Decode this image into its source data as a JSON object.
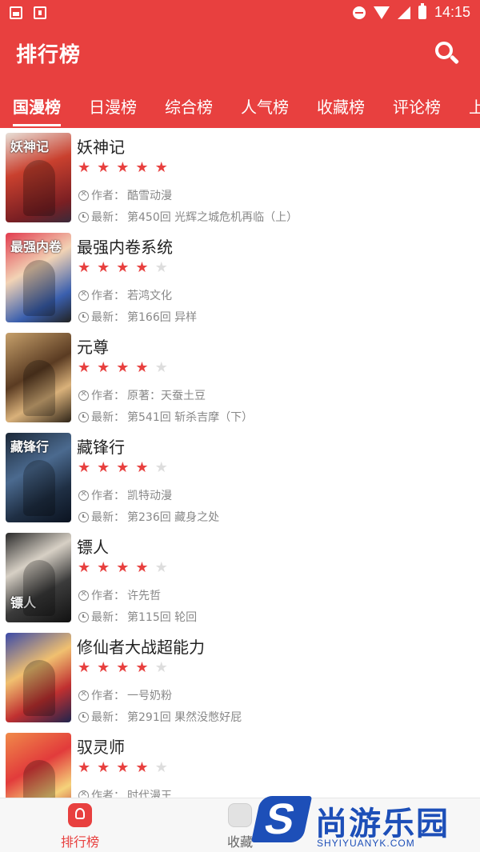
{
  "status_bar": {
    "time": "14:15"
  },
  "app_bar": {
    "title": "排行榜"
  },
  "tabs": [
    {
      "label": "国漫榜",
      "active": true
    },
    {
      "label": "日漫榜"
    },
    {
      "label": "综合榜"
    },
    {
      "label": "人气榜"
    },
    {
      "label": "收藏榜"
    },
    {
      "label": "评论榜"
    },
    {
      "label": "上"
    }
  ],
  "accent_color": "#e8403f",
  "comics": [
    {
      "title": "妖神记",
      "rating": 5,
      "author_label": "作者：",
      "author": "酷雪动漫",
      "latest_label": "最新：",
      "latest": "第450回 光辉之城危机再临（上）",
      "cover_text": "妖神记"
    },
    {
      "title": "最强内卷系统",
      "rating": 4,
      "author_label": "作者：",
      "author": "若鸿文化",
      "latest_label": "最新：",
      "latest": "第166回 异样",
      "cover_text": "最强内卷"
    },
    {
      "title": "元尊",
      "rating": 4,
      "author_label": "作者：",
      "author": "原著：天蚕土豆",
      "latest_label": "最新：",
      "latest": "第541回 斩杀吉摩（下）",
      "cover_text": ""
    },
    {
      "title": "藏锋行",
      "rating": 4,
      "author_label": "作者：",
      "author": "凯特动漫",
      "latest_label": "最新：",
      "latest": "第236回 藏身之处",
      "cover_text": "藏锋行"
    },
    {
      "title": "镖人",
      "rating": 4,
      "author_label": "作者：",
      "author": "许先哲",
      "latest_label": "最新：",
      "latest": "第115回 轮回",
      "cover_text": "镖人"
    },
    {
      "title": "修仙者大战超能力",
      "rating": 4,
      "author_label": "作者：",
      "author": "一号奶粉",
      "latest_label": "最新：",
      "latest": "第291回 果然没憋好屁",
      "cover_text": ""
    },
    {
      "title": "驭灵师",
      "rating": 4,
      "author_label": "作者：",
      "author": "时代漫王",
      "latest_label": "",
      "latest": "",
      "cover_text": ""
    }
  ],
  "bottom_nav": [
    {
      "label": "排行榜",
      "icon": "ranking-icon",
      "active": true
    },
    {
      "label": "收藏",
      "icon": "bookshelf-icon",
      "active": false
    }
  ],
  "watermark": {
    "text": "尚游乐园",
    "sub": "SHYIYUANYK.COM",
    "logo_letter": "S"
  }
}
